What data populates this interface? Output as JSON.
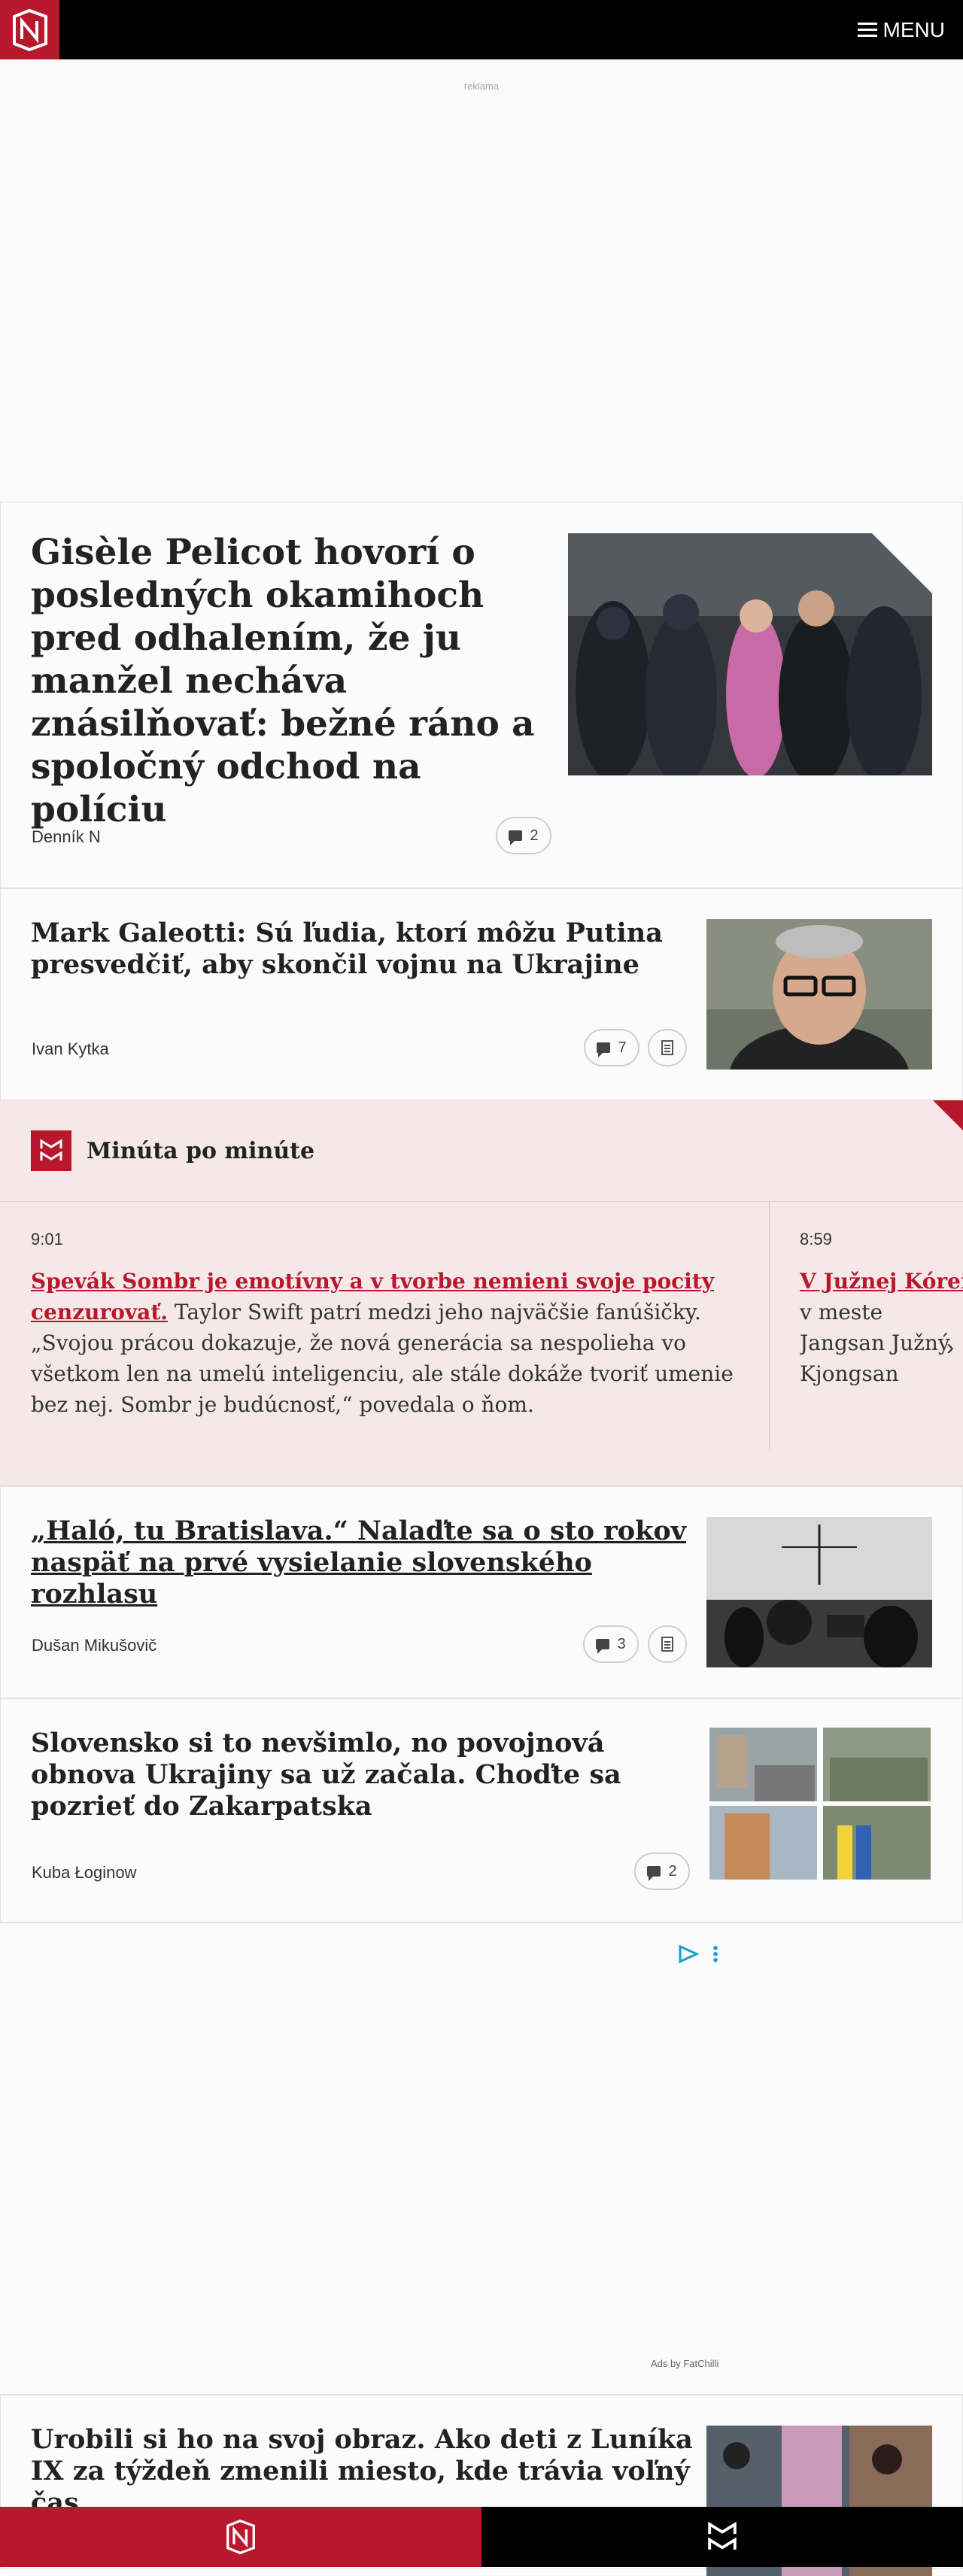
{
  "header": {
    "menu_label": "MENU"
  },
  "ad_top": {
    "label": "reklama"
  },
  "articles": [
    {
      "title": "Gisèle Pelicot hovorí o posledných okamihoch pred odhalením, že ju manžel nechávа znásilňovať: bežné ráno a spoločný odchod na políciu",
      "author": "Denník N",
      "comments": "2"
    },
    {
      "title": "Mark Galeotti: Sú ľudia, ktorí môžu Putina presvedčiť, aby skončil vojnu na Ukrajine",
      "author": "Ivan Kytka",
      "comments": "7"
    },
    {
      "title": "„Haló, tu Bratislava.“ Nalaďte sa o sto rokov naspäť na prvé vysielanie slovenského rozhlasu",
      "author": "Dušan Mikušovič",
      "comments": "3"
    },
    {
      "title": "Slovensko si to nevšimlo, no povojnová obnova Ukrajiny sa už začala. Choďte sa pozrieť do Zakarpatska",
      "author": "Kuba Łoginow",
      "comments": "2"
    },
    {
      "title": "Urobili si ho na svoj obraz. Ako deti z Luníka IX za týždeň zmenili miesto, kde trávia voľný čas"
    }
  ],
  "live": {
    "title": "Minúta po minúte",
    "items": [
      {
        "time": "9:01",
        "headline": "Spevák Sombr je emotívny a v tvorbe nemieni svoje pocity cenzurovať.",
        "text": " Taylor Swift patrí medzi jeho najväčšie fanúšičky. „Svojou prácou dokazuje, že nová generácia sa nespolieha vo všetkom len na umelú inteligenciu, ale stále dokáže tvoriť umenie bez nej. Sombr je budúcnosť,“ povedala o ňom."
      },
      {
        "time": "8:59",
        "headline": "V Južnej Kórei",
        "text": " v meste Jangsan Južný Kjongsan"
      }
    ]
  },
  "ad_mid": {
    "by_label": "Ads by FatChilli"
  },
  "colors": {
    "brand": "#b8182c",
    "black": "#000000"
  }
}
